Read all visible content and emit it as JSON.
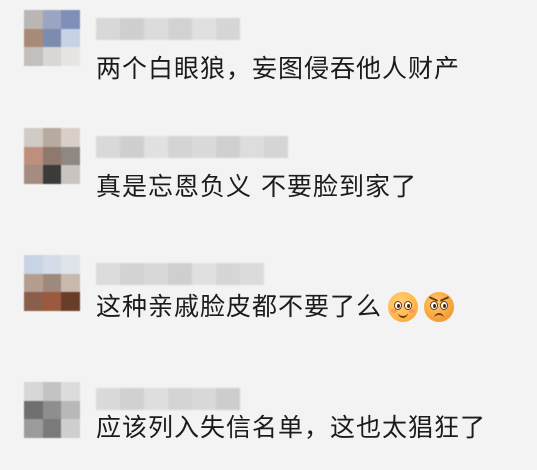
{
  "comments": [
    {
      "text": "两个白眼狼，妄图侵吞他人财产",
      "avatar_colors": [
        "#b9b6b3",
        "#9aa5c2",
        "#7f8fb8",
        "#a88a78",
        "#7c8cae",
        "#c8d2e6",
        "#c2bfbd",
        "#d9d7d5",
        "#e6e5e4"
      ],
      "username_colors": [
        "#d8d8d8",
        "#cfcfcf",
        "#dcdcdc",
        "#d2d2d2",
        "#e0e0e0",
        "#d6d6d6"
      ]
    },
    {
      "text": "真是忘恩负义 不要脸到家了",
      "avatar_colors": [
        "#d2cbc5",
        "#b7aa9e",
        "#d8d0c8",
        "#bd8f7c",
        "#8e7a6c",
        "#8f8781",
        "#a48c80",
        "#3b3b3b",
        "#c9c4bf"
      ],
      "username_colors": [
        "#d9d9d9",
        "#cfcfcf",
        "#e1e1e1",
        "#d4d4d4",
        "#dadada",
        "#d0d0d0",
        "#dddddd",
        "#d5d5d5"
      ]
    },
    {
      "text": "这种亲戚脸皮都不要了么",
      "avatar_colors": [
        "#c9d3e6",
        "#d4dbe9",
        "#dfe3ea",
        "#b59e8f",
        "#9e8a7c",
        "#c8b8ad",
        "#8a5e4b",
        "#9b5a3e",
        "#6a3c2a"
      ],
      "username_colors": [
        "#dcdcdc",
        "#d3d3d3",
        "#d8d8d8",
        "#cfcfcf",
        "#e0e0e0",
        "#d6d6d6",
        "#dbdbdb"
      ],
      "emojis": [
        "pleading-face-emoji",
        "angry-face-emoji"
      ]
    },
    {
      "text": "应该列入失信名单，这也太猖狂了",
      "avatar_colors": [
        "#d7d7d7",
        "#c3c3c3",
        "#dcdcdc",
        "#6f6f6f",
        "#8e8e8e",
        "#b8b8b8",
        "#9b9b9b",
        "#7a7a7a",
        "#cfcfcf"
      ],
      "username_colors": [
        "#dadada",
        "#d1d1d1",
        "#dedede",
        "#d4d4d4",
        "#d8d8d8",
        "#cdcdcd"
      ]
    }
  ]
}
